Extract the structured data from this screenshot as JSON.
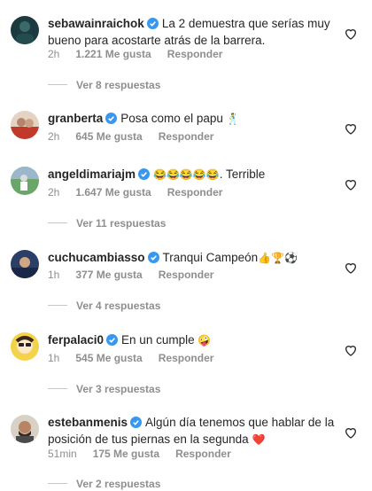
{
  "verified_color": "#3897f0",
  "comments": [
    {
      "username": "sebawainraichok",
      "text": "La 2 demuestra que serías muy",
      "text2": "bueno para acostarte atrás de la barrera.",
      "time": "2h",
      "likes": "1.221 Me gusta",
      "reply": "Responder",
      "replies": "Ver 8 respuestas"
    },
    {
      "username": "granberta",
      "text": "Posa como el papu",
      "emoji": "🕺",
      "time": "2h",
      "likes": "645 Me gusta",
      "reply": "Responder"
    },
    {
      "username": "angeldimariajm",
      "emoji": "😂😂😂😂😂",
      "text": ". Terrible",
      "time": "2h",
      "likes": "1.647 Me gusta",
      "reply": "Responder",
      "replies": "Ver 11 respuestas"
    },
    {
      "username": "cuchucambiasso",
      "text": "Tranqui Campeón",
      "emoji": "👍🏆⚽",
      "time": "1h",
      "likes": "377 Me gusta",
      "reply": "Responder",
      "replies": "Ver 4 respuestas"
    },
    {
      "username": "ferpalaci0",
      "text": "En un cumple",
      "emoji": "🤪",
      "time": "1h",
      "likes": "545 Me gusta",
      "reply": "Responder",
      "replies": "Ver 3 respuestas"
    },
    {
      "username": "estebanmenis",
      "text": "Algún día tenemos que hablar de la",
      "text2": "posición de tus piernas en la segunda",
      "emoji": "❤️",
      "time": "51min",
      "likes": "175 Me gusta",
      "reply": "Responder",
      "replies": "Ver 2 respuestas"
    }
  ]
}
